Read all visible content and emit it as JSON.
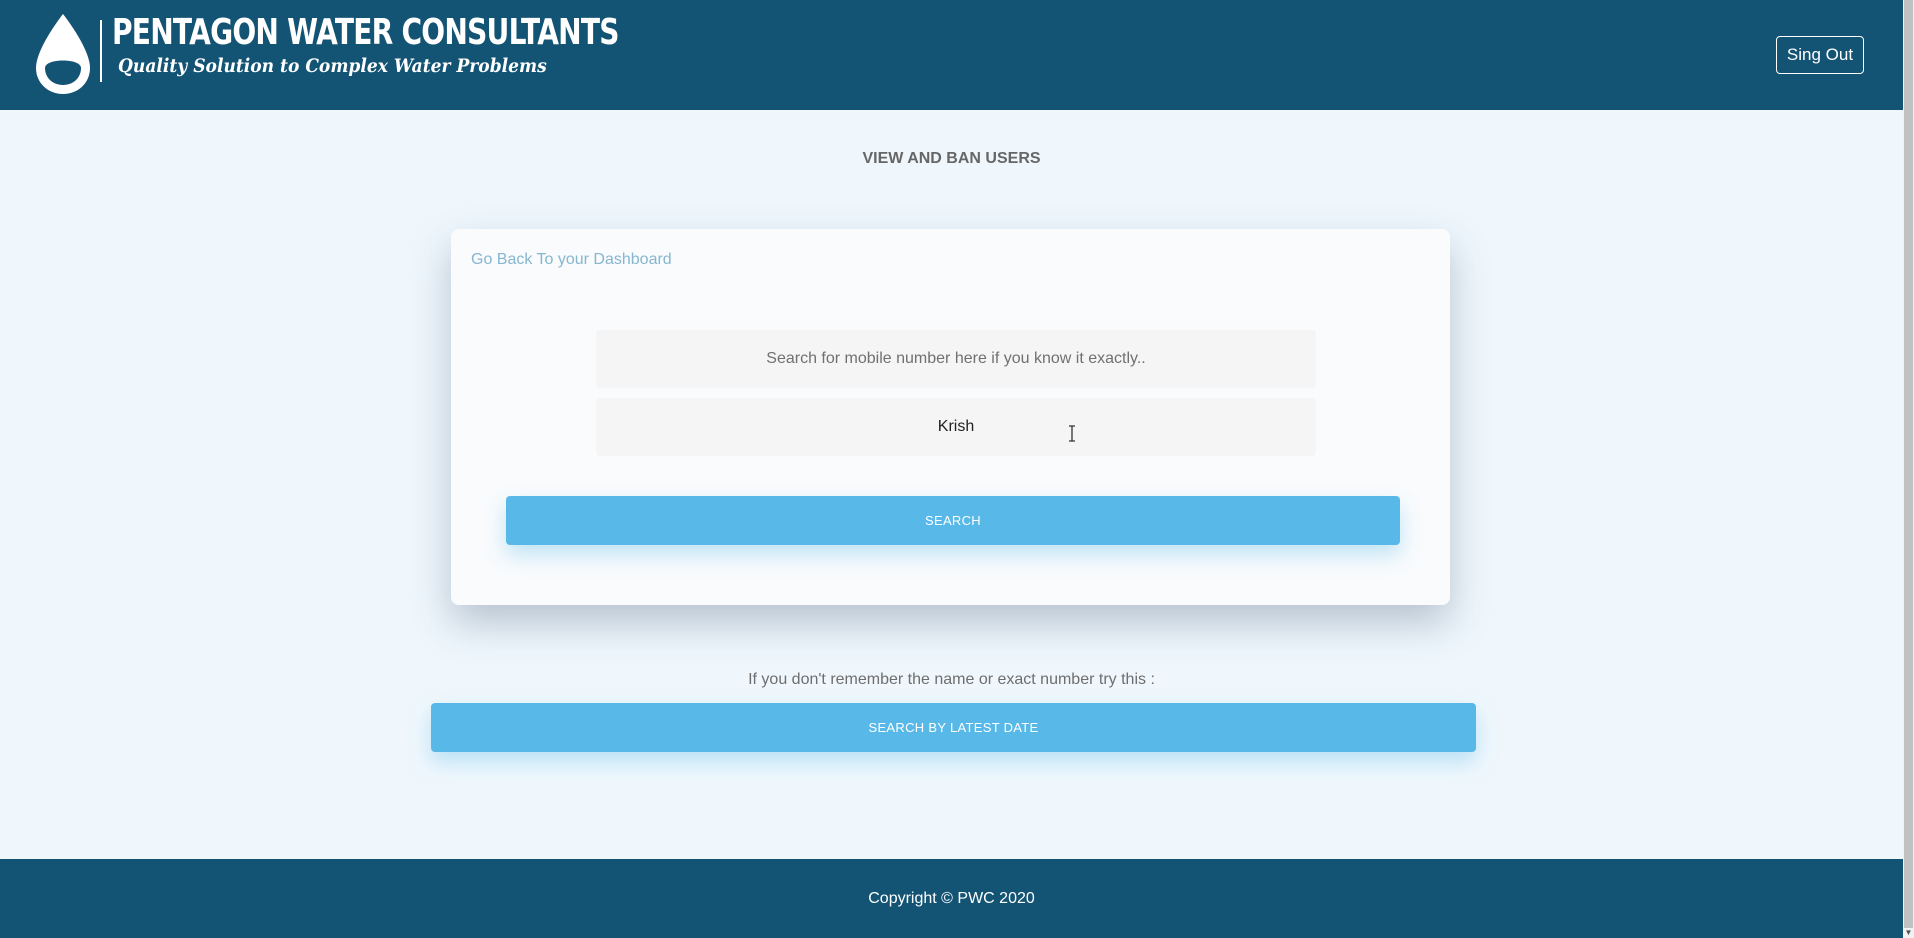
{
  "header": {
    "brand_name": "PENTAGON WATER CONSULTANTS",
    "tagline": "Quality Solution to Complex Water Problems",
    "signout_label": "Sing Out"
  },
  "main": {
    "page_title": "VIEW AND BAN USERS",
    "card": {
      "back_link": "Go Back To your Dashboard",
      "mobile_placeholder": "Search for mobile number here if you know it exactly..",
      "name_value": "Krish",
      "search_label": "SEARCH"
    },
    "hint": "If you don't remember the name or exact number try this :",
    "date_search_label": "SEARCH BY LATEST DATE"
  },
  "footer": {
    "copyright": "Copyright © PWC 2020"
  },
  "colors": {
    "header_bg": "#135474",
    "page_bg": "#eff7fd",
    "accent": "#58b9e9",
    "link": "#86b6d0"
  },
  "icons": {
    "logo": "water-drop-icon",
    "cursor": "text-cursor-icon"
  }
}
